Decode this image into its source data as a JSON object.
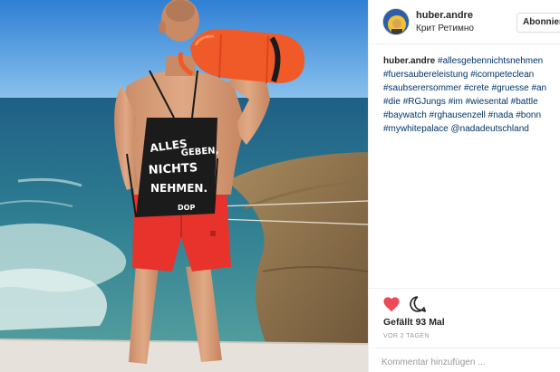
{
  "post": {
    "username": "huber.andre",
    "location": "Крит Ретимно",
    "follow_label": "Abonnieren",
    "caption_user": "huber.andre",
    "caption_tags": [
      "#allesgebennichtsnehmen",
      "#fuersaubereleistung",
      "#icompeteclean",
      "#saubserersommer",
      "#crete",
      "#gruesse",
      "#an",
      "#die",
      "#RGJungs",
      "#im",
      "#wiesental",
      "#battle",
      "#baywatch",
      "#rghausenzell",
      "#nada",
      "#bonn",
      "#mywhitepalace",
      "@nadadeutschland"
    ],
    "likes_text": "Gefällt 93 Mal",
    "time_text": "VOR 2 TAGEN",
    "comment_placeholder": "Kommentar hinzufügen ...",
    "photo": {
      "bag_text_line1": "ALLES",
      "bag_text_line2": "GEBEN,",
      "bag_text_line3": "NICHTS",
      "bag_text_line4": "NEHMEN.",
      "bag_logo": "DOP"
    }
  },
  "icons": {
    "heart": "heart-icon",
    "comment": "comment-icon"
  },
  "colors": {
    "heart": "#ed4956",
    "hashtag": "#003569",
    "shorts": "#e8322c",
    "rescue_tube": "#f05a28"
  }
}
